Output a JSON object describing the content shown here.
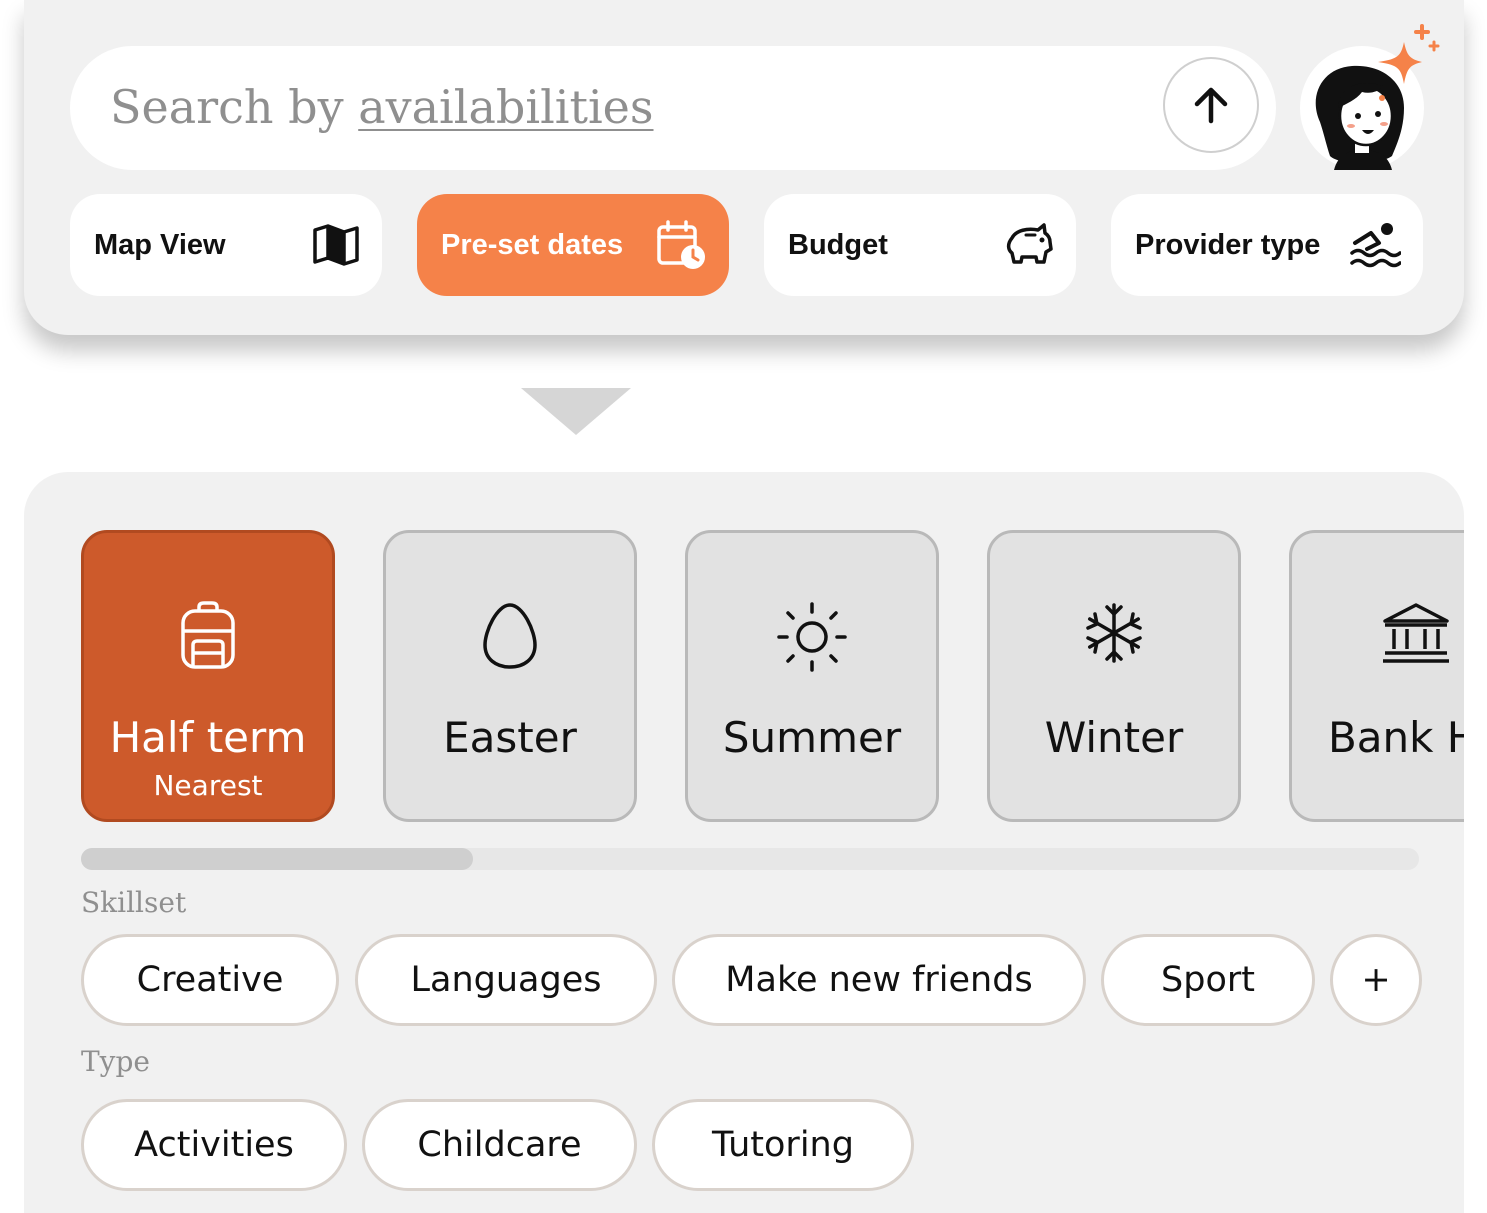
{
  "search": {
    "placeholder_prefix": "Search by ",
    "placeholder_keyword": "availabilities"
  },
  "filters": [
    {
      "label": "Map View",
      "icon": "map-icon",
      "active": false
    },
    {
      "label": "Pre-set dates",
      "icon": "calendar-clock-icon",
      "active": true
    },
    {
      "label": "Budget",
      "icon": "piggy-bank-icon",
      "active": false
    },
    {
      "label": "Provider type",
      "icon": "swimmer-icon",
      "active": false
    }
  ],
  "seasons": [
    {
      "name": "Half term",
      "sub": "Nearest",
      "icon": "backpack-icon",
      "active": true
    },
    {
      "name": "Easter",
      "sub": "",
      "icon": "egg-icon",
      "active": false
    },
    {
      "name": "Summer",
      "sub": "",
      "icon": "sun-icon",
      "active": false
    },
    {
      "name": "Winter",
      "sub": "",
      "icon": "snowflake-icon",
      "active": false
    },
    {
      "name": "Bank Ho",
      "sub": "",
      "icon": "bank-icon",
      "active": false
    }
  ],
  "skillset": {
    "label": "Skillset",
    "chips": [
      "Creative",
      "Languages",
      "Make new friends",
      "Sport",
      "+"
    ]
  },
  "type": {
    "label": "Type",
    "chips": [
      "Activities",
      "Childcare",
      "Tutoring"
    ]
  },
  "colors": {
    "accent": "#f58249",
    "active_card": "#cd5a2b",
    "panel": "#f1f1f1"
  }
}
